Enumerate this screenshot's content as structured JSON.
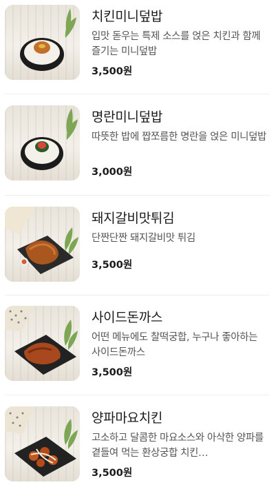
{
  "menu": {
    "items": [
      {
        "name": "치킨미니덮밥",
        "description": "입맛 돋우는 특제 소스를 얹은 치킨과 함께 즐기는 미니덮밥",
        "price": "3,500원",
        "image_icon": "rice-bowl-chicken-icon"
      },
      {
        "name": "명란미니덮밥",
        "description": "따뜻한 밥에 짭쪼름한 명란을 얹은 미니덮밥",
        "price": "3,000원",
        "image_icon": "rice-bowl-pollack-roe-icon"
      },
      {
        "name": "돼지갈비맛튀김",
        "description": "단짠단짠 돼지갈비맛 튀김",
        "price": "3,500원",
        "image_icon": "fried-pork-plate-icon"
      },
      {
        "name": "사이드돈까스",
        "description": "어떤 메뉴에도 찰떡궁합, 누구나 좋아하는 사이드돈까스",
        "price": "3,500원",
        "image_icon": "pork-cutlet-plate-icon"
      },
      {
        "name": "양파마요치킨",
        "description": "고소하고 달콤한 마요소스와 아삭한 양파를 곁들여 먹는 환상궁합 치킨…",
        "price": "3,500원",
        "image_icon": "onion-mayo-chicken-plate-icon"
      }
    ]
  }
}
